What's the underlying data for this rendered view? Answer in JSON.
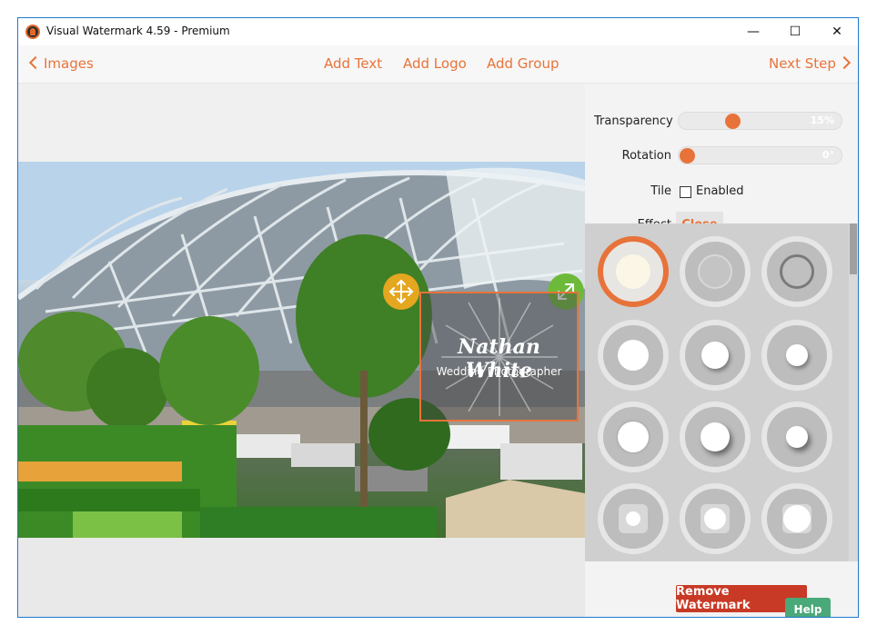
{
  "window": {
    "title": "Visual Watermark 4.59 - Premium",
    "controls": {
      "minimize": "—",
      "maximize": "☐",
      "close": "✕"
    }
  },
  "nav": {
    "back_label": "Images",
    "add_text": "Add Text",
    "add_logo": "Add Logo",
    "add_group": "Add Group",
    "next_label": "Next Step"
  },
  "watermark": {
    "name": "Nathan White",
    "subtitle": "Wedding Photographer"
  },
  "settings": {
    "transparency_label": "Transparency",
    "transparency_value": "15%",
    "transparency_level": 0.15,
    "rotation_label": "Rotation",
    "rotation_value": "0°",
    "rotation_level": 0,
    "tile_label": "Tile",
    "tile_option": "Enabled",
    "tile_enabled": false,
    "effect_label": "Effect",
    "effect_close": "Close"
  },
  "effects": {
    "selected_index": 0,
    "count": 12
  },
  "actions": {
    "remove_watermark": "Remove Watermark",
    "help": "Help"
  },
  "colors": {
    "accent": "#e8733a",
    "remove": "#c83a26",
    "help": "#4aa978"
  }
}
